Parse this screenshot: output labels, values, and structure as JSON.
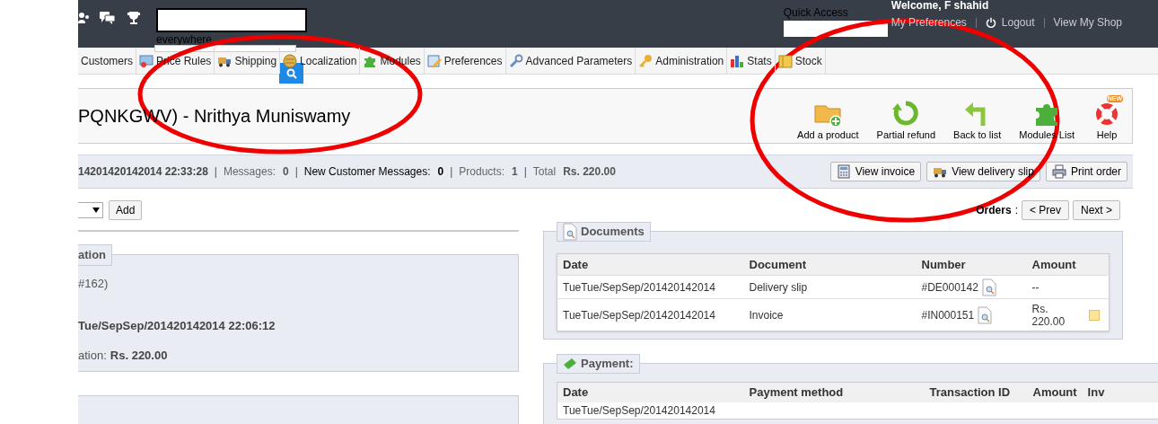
{
  "header": {
    "search_scope": "everywhere",
    "quick_access": {
      "label": "Quick Access"
    },
    "welcome": "Welcome, F shahid",
    "links": [
      {
        "label": "My Preferences",
        "kind": "text"
      },
      {
        "label": "Logout",
        "kind": "power"
      },
      {
        "label": "View My Shop",
        "kind": "text"
      }
    ]
  },
  "menu": [
    {
      "label": "Customers",
      "kind": "none"
    },
    {
      "label": "Price Rules",
      "kind": "card"
    },
    {
      "label": "Shipping",
      "kind": "truck"
    },
    {
      "label": "Localization",
      "kind": "globe"
    },
    {
      "label": "Modules",
      "kind": "puzzle"
    },
    {
      "label": "Preferences",
      "kind": "pencil"
    },
    {
      "label": "Advanced Parameters",
      "kind": "wrench"
    },
    {
      "label": "Administration",
      "kind": "key"
    },
    {
      "label": "Stats",
      "kind": "chart"
    },
    {
      "label": "Stock",
      "kind": "box"
    }
  ],
  "page_title": "PQNKGWV) - Nrithya Muniswamy",
  "toolbar": [
    {
      "label": "Add a product",
      "kind": "folder"
    },
    {
      "label": "Partial refund",
      "kind": "refund"
    },
    {
      "label": "Back to list",
      "kind": "back"
    },
    {
      "label": "Modules List",
      "kind": "puzzle"
    },
    {
      "label": "Help",
      "kind": "help",
      "badge": "NEW"
    }
  ],
  "summary": {
    "date": "14201420142014 22:33:28",
    "items": [
      {
        "separator": "|",
        "label": "Messages:",
        "value": "0",
        "strong": false
      },
      {
        "separator": "|",
        "label": "New Customer Messages:",
        "value": "0",
        "strong": true
      },
      {
        "separator": "|",
        "label": "Products:",
        "value": "1",
        "strong": false
      },
      {
        "separator": "|",
        "label": "Total",
        "value": "Rs. 220.00",
        "strong": false
      }
    ]
  },
  "summary_buttons": [
    {
      "label": "View invoice",
      "kind": "calculator"
    },
    {
      "label": "View delivery slip",
      "kind": "truck"
    },
    {
      "label": "Print order",
      "kind": "printer"
    }
  ],
  "add_button": "Add",
  "orders_nav": {
    "label": "Orders",
    "separator": ":",
    "prev": "< Prev",
    "next": "Next >"
  },
  "left_panel": {
    "legend": "ation",
    "lines": [
      {
        "text": "#162)",
        "kind": "plain"
      },
      {
        "text": "Tue/SepSep/201420142014 22:06:12",
        "kind": "bold"
      },
      {
        "text": "ation:",
        "value": "Rs. 220.00",
        "kind": "labeled"
      }
    ]
  },
  "documents": {
    "legend": "Documents",
    "columns": [
      "Date",
      "Document",
      "Number",
      "Amount"
    ],
    "rows": [
      {
        "date": "TueTue/SepSep/201420142014",
        "document": "Delivery slip",
        "number": "#DE000142",
        "amount": "--",
        "note": false
      },
      {
        "date": "TueTue/SepSep/201420142014",
        "document": "Invoice",
        "number": "#IN000151",
        "amount": "Rs. 220.00",
        "note": true
      }
    ]
  },
  "payment": {
    "legend": "Payment:",
    "columns": [
      "Date",
      "Payment method",
      "Transaction ID",
      "Amount",
      "Inv"
    ],
    "rows": [
      {
        "date": "TueTue/SepSep/201420142014"
      }
    ]
  }
}
